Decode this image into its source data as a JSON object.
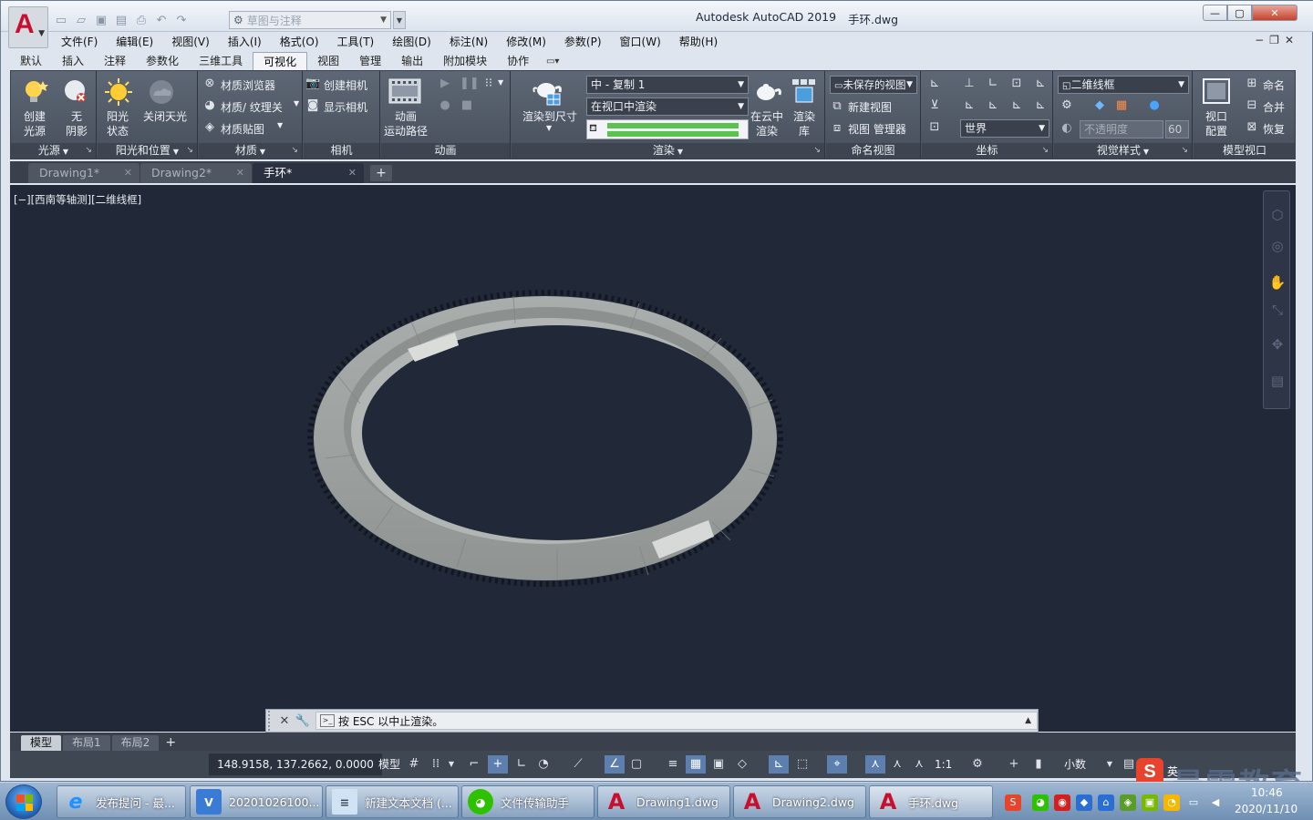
{
  "titlebar": {
    "app_title": "Autodesk AutoCAD 2019",
    "file_name": "手环.dwg",
    "workspace": "草图与注释",
    "logo_letter": "A"
  },
  "menubar": {
    "items": [
      "文件(F)",
      "编辑(E)",
      "视图(V)",
      "插入(I)",
      "格式(O)",
      "工具(T)",
      "绘图(D)",
      "标注(N)",
      "修改(M)",
      "参数(P)",
      "窗口(W)",
      "帮助(H)"
    ]
  },
  "ribbon_tabs": {
    "items": [
      "默认",
      "插入",
      "注释",
      "参数化",
      "三维工具",
      "可视化",
      "视图",
      "管理",
      "输出",
      "附加模块",
      "协作"
    ],
    "active": "可视化"
  },
  "ribbon": {
    "lights": {
      "title": "光源",
      "create_light": [
        "创建",
        "光源"
      ],
      "no_shadow": [
        "无",
        "阴影"
      ]
    },
    "sun": {
      "title": "阳光和位置",
      "sun_status": [
        "阳光",
        "状态"
      ],
      "sky_off": [
        "关闭天光"
      ]
    },
    "materials": {
      "title": "材质",
      "browser": "材质浏览器",
      "texture": "材质/ 纹理关",
      "mapping": "材质贴图"
    },
    "camera": {
      "title": "相机",
      "create": "创建相机",
      "show": "显示相机"
    },
    "animation": {
      "title": "动画",
      "motion_path": [
        "动画",
        "运动路径"
      ]
    },
    "render": {
      "title": "渲染",
      "render_to_size": "渲染到尺寸",
      "preset": "中 - 复制 1",
      "target": "在视口中渲染",
      "cloud": [
        "在云中",
        "渲染"
      ],
      "gallery": [
        "渲染",
        "库"
      ],
      "progress": 0.96
    },
    "named_views": {
      "title": "命名视图",
      "unsaved": "未保存的视图",
      "new_view": "新建视图",
      "manager": "视图 管理器"
    },
    "coordinates": {
      "title": "坐标",
      "ucs": "世界"
    },
    "visual_styles": {
      "title": "视觉样式",
      "style": "二维线框",
      "transparency_label": "不透明度",
      "transparency_value": "60"
    },
    "model_viewports": {
      "title": "模型视口",
      "config": [
        "视口",
        "配置"
      ],
      "name": "命名",
      "join": "合并",
      "restore": "恢复"
    }
  },
  "doc_tabs": {
    "items": [
      "Drawing1*",
      "Drawing2*",
      "手环*"
    ],
    "active": 2
  },
  "viewport": {
    "label": "[−][西南等轴测][二维线框]",
    "bg": "#212938",
    "ring_color": "#a4a8a6"
  },
  "command_line": {
    "text": "按 ESC 以中止渲染。"
  },
  "layout_tabs": {
    "items": [
      "模型",
      "布局1",
      "布局2"
    ],
    "active": 0
  },
  "status_bar": {
    "coords": "148.9158, 137.2662, 0.0000",
    "model": "模型",
    "scale": "1:1",
    "units": "小数"
  },
  "taskbar": {
    "items": [
      {
        "label": "发布提问 - 最...",
        "icon": "ie-icon"
      },
      {
        "label": "20201026100...",
        "icon": "app-v-icon"
      },
      {
        "label": "新建文本文档 (...",
        "icon": "notepad-icon"
      },
      {
        "label": "文件传输助手",
        "icon": "wechat-icon"
      },
      {
        "label": "Drawing1.dwg",
        "icon": "autocad-icon"
      },
      {
        "label": "Drawing2.dwg",
        "icon": "autocad-icon"
      },
      {
        "label": "手环.dwg",
        "icon": "autocad-icon"
      }
    ],
    "date": "2020/11/10",
    "time": "10:46"
  },
  "watermark": {
    "text": "最需教育",
    "ime": "英"
  }
}
